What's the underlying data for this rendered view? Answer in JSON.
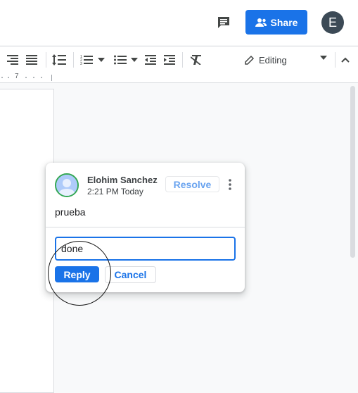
{
  "header": {
    "share_label": "Share",
    "account_initial": "E",
    "icons": {
      "comment_history": "comment-history-icon",
      "share": "person-icon"
    }
  },
  "toolbar": {
    "icons": [
      "align-right-icon",
      "align-justify-icon",
      "line-spacing-icon",
      "numbered-list-icon",
      "dropdown-icon",
      "bulleted-list-icon",
      "dropdown-icon",
      "decrease-indent-icon",
      "increase-indent-icon",
      "clear-formatting-icon",
      "pencil-icon",
      "collapse-icon"
    ],
    "editing_label": "Editing"
  },
  "ruler": {
    "mark": "7"
  },
  "comment": {
    "author": "Elohim Sanchez",
    "time": "2:21 PM Today",
    "resolve_label": "Resolve",
    "text": "prueba",
    "reply_value": "done",
    "reply_label": "Reply",
    "cancel_label": "Cancel"
  },
  "colors": {
    "accent": "#1a73e8",
    "avatar_bg": "#3c4a56",
    "avatar_ring": "#34a853"
  }
}
